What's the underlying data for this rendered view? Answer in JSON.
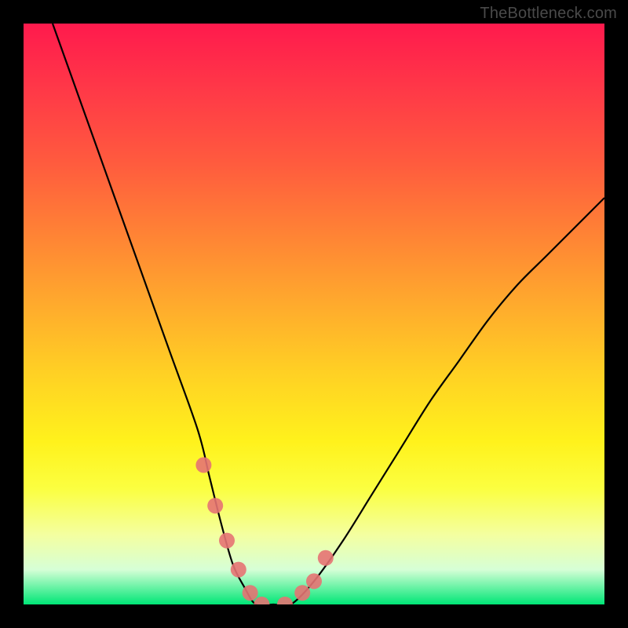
{
  "watermark": {
    "text": "TheBottleneck.com"
  },
  "colors": {
    "frame": "#000000",
    "curve": "#000000",
    "marker": "#e57373",
    "gradient_top": "#ff1a4d",
    "gradient_mid": "#ffe020",
    "gradient_bottom": "#00e676"
  },
  "chart_data": {
    "type": "line",
    "title": "",
    "xlabel": "",
    "ylabel": "",
    "xlim": [
      0,
      100
    ],
    "ylim": [
      0,
      100
    ],
    "grid": false,
    "series": [
      {
        "name": "bottleneck-curve",
        "x": [
          5,
          10,
          15,
          20,
          25,
          30,
          32,
          34,
          36,
          38,
          40,
          43,
          46,
          50,
          55,
          60,
          65,
          70,
          75,
          80,
          85,
          90,
          95,
          100
        ],
        "values": [
          100,
          86,
          72,
          58,
          44,
          30,
          22,
          14,
          7,
          3,
          0,
          0,
          0,
          4,
          11,
          19,
          27,
          35,
          42,
          49,
          55,
          60,
          65,
          70
        ]
      }
    ],
    "markers": {
      "name": "highlight-points",
      "x": [
        31,
        33,
        35,
        37,
        39,
        41,
        45,
        48,
        50,
        52
      ],
      "values": [
        24,
        17,
        11,
        6,
        2,
        0,
        0,
        2,
        4,
        8
      ]
    }
  }
}
